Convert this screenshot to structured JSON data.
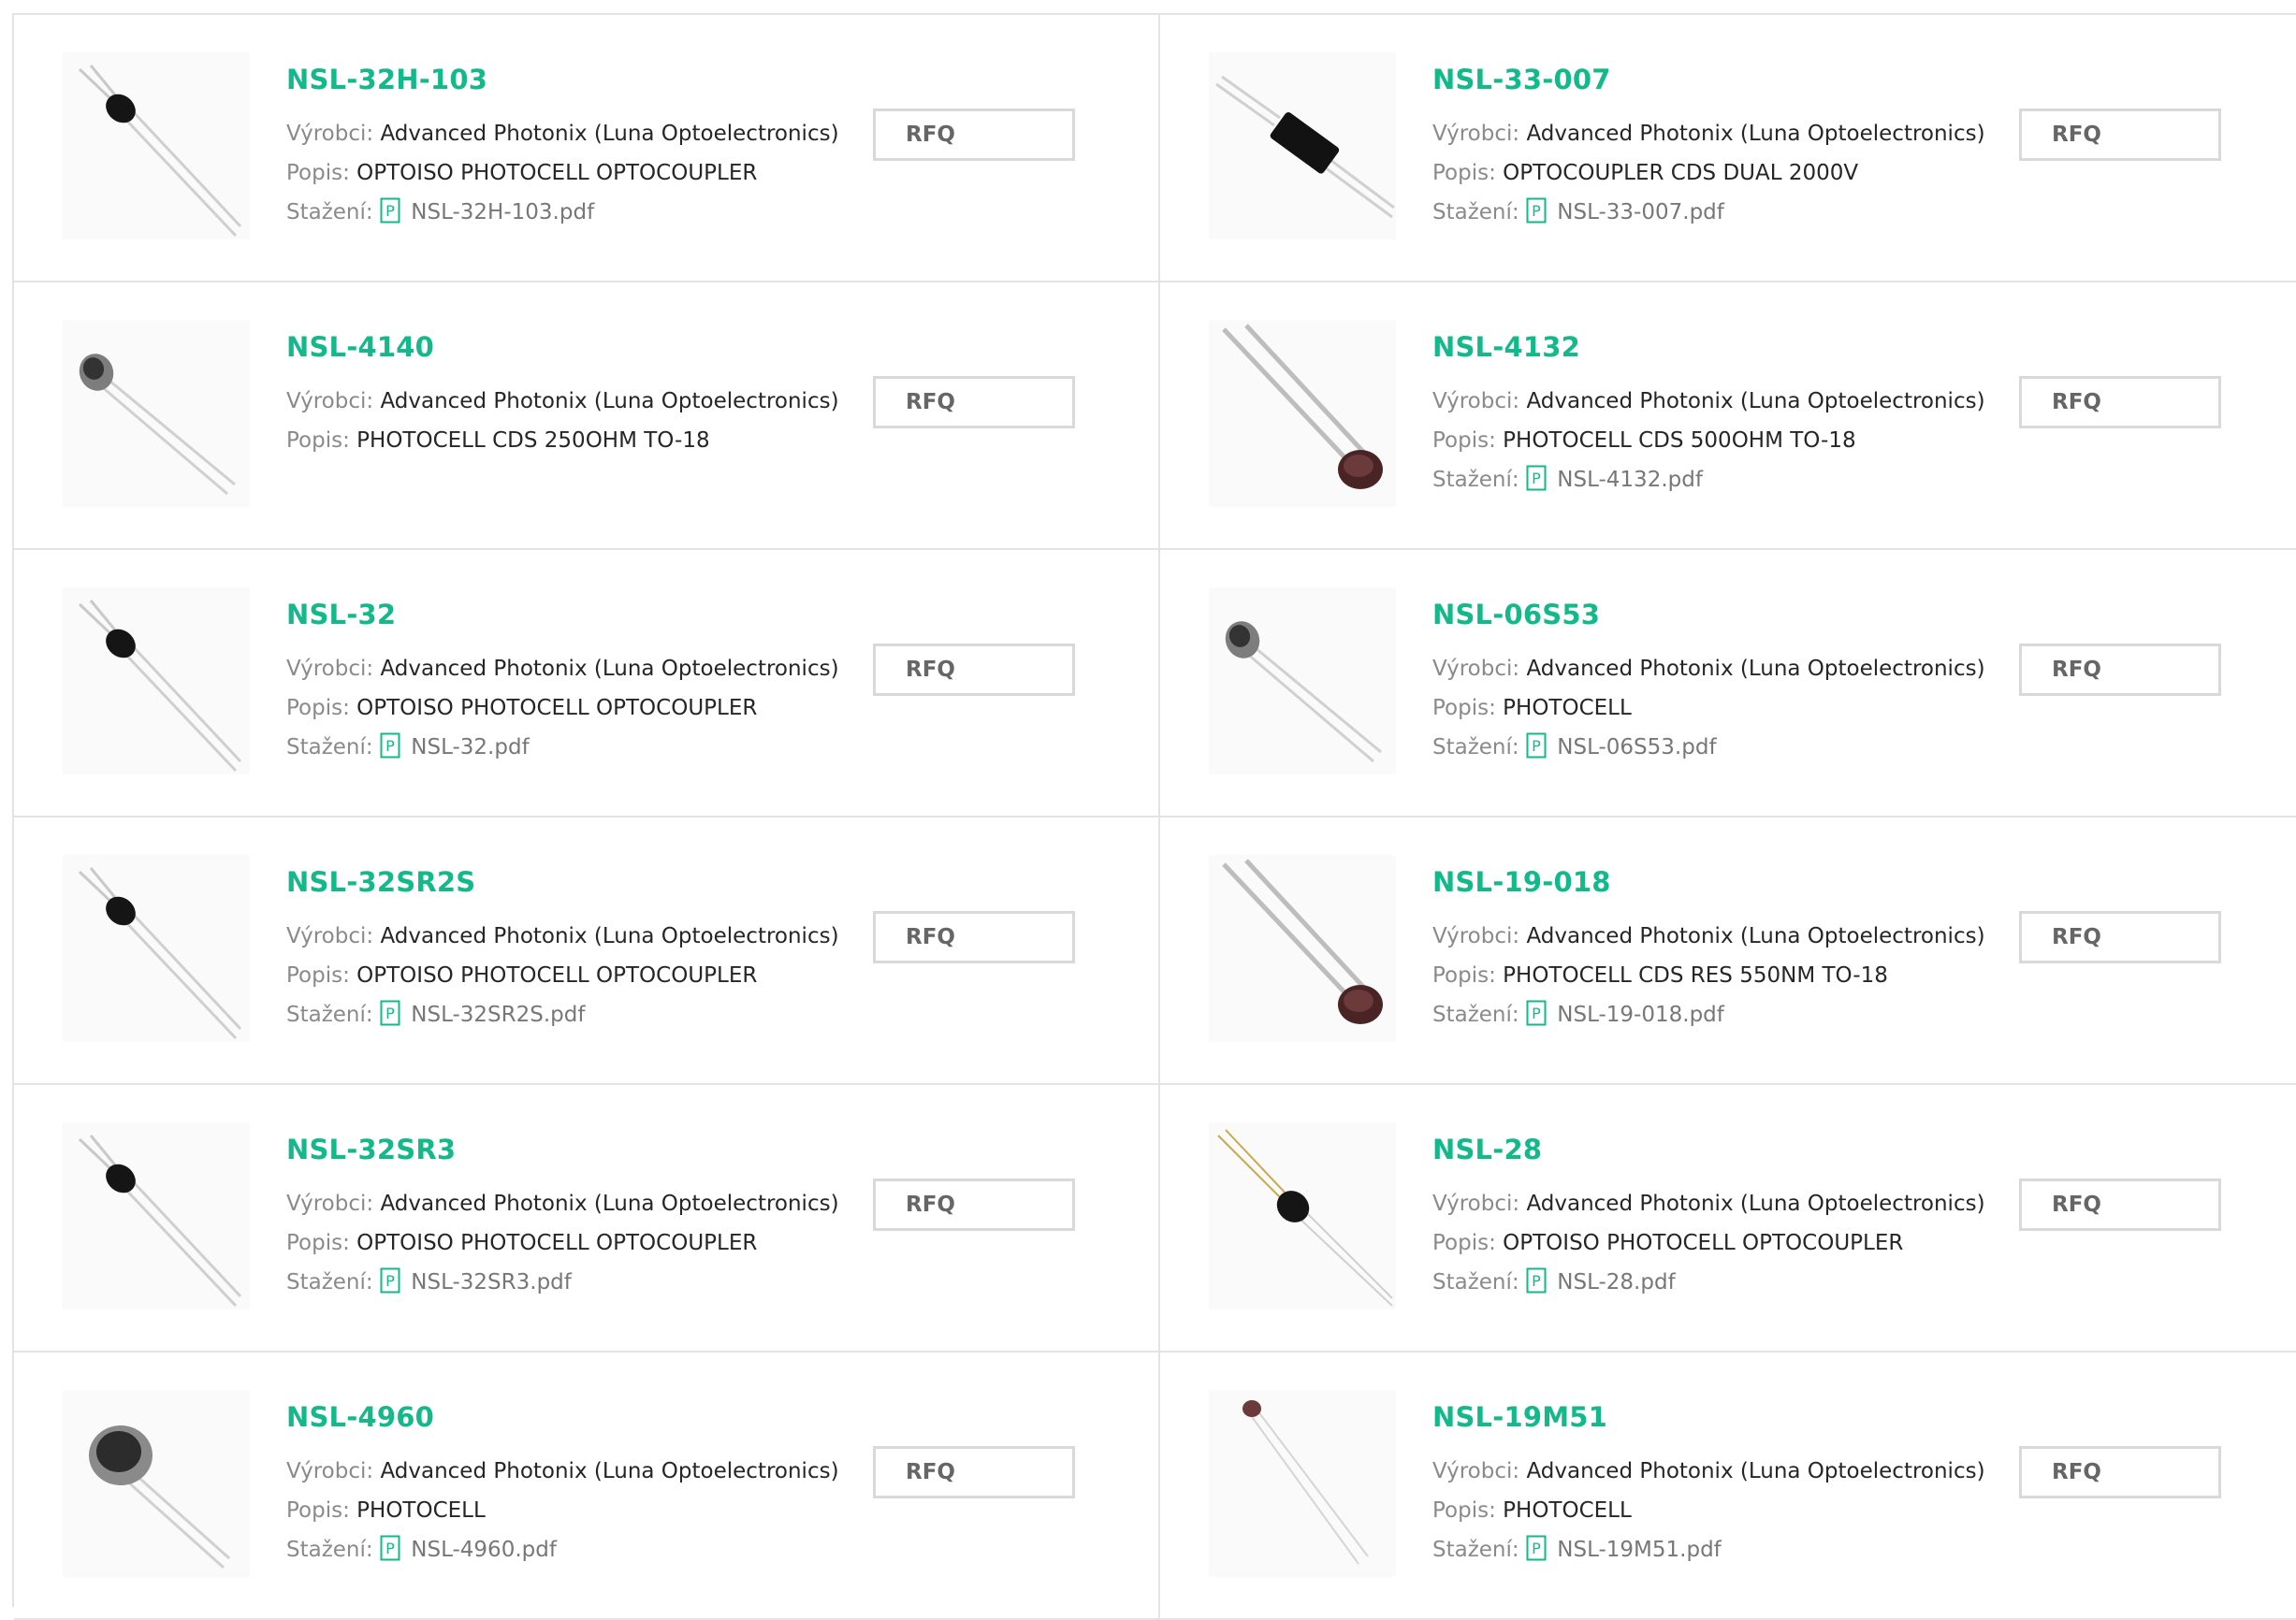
{
  "labels": {
    "manufacturer": "Výrobci:",
    "description": "Popis:",
    "download": "Stažení:",
    "rfq": "RFQ"
  },
  "colors": {
    "accent": "#13b98a",
    "label_gray": "#8a8a8a",
    "border": "#e3e3e3"
  },
  "products": [
    {
      "part": "NSL-32H-103",
      "manufacturer": "Advanced Photonix (Luna Optoelectronics)",
      "description": "OPTOISO PHOTOCELL OPTOCOUPLER",
      "pdf": "NSL-32H-103.pdf",
      "icon": "optocoupler-image"
    },
    {
      "part": "NSL-33-007",
      "manufacturer": "Advanced Photonix (Luna Optoelectronics)",
      "description": "OPTOCOUPLER CDS DUAL 2000V",
      "pdf": "NSL-33-007.pdf",
      "icon": "dual-optocoupler-image"
    },
    {
      "part": "NSL-4140",
      "manufacturer": "Advanced Photonix (Luna Optoelectronics)",
      "description": "PHOTOCELL CDS 250OHM TO-18",
      "pdf": null,
      "icon": "to18-photocell-image"
    },
    {
      "part": "NSL-4132",
      "manufacturer": "Advanced Photonix (Luna Optoelectronics)",
      "description": "PHOTOCELL CDS 500OHM TO-18",
      "pdf": "NSL-4132.pdf",
      "icon": "ldr-photocell-image"
    },
    {
      "part": "NSL-32",
      "manufacturer": "Advanced Photonix (Luna Optoelectronics)",
      "description": "OPTOISO PHOTOCELL OPTOCOUPLER",
      "pdf": "NSL-32.pdf",
      "icon": "optocoupler-image"
    },
    {
      "part": "NSL-06S53",
      "manufacturer": "Advanced Photonix (Luna Optoelectronics)",
      "description": "PHOTOCELL",
      "pdf": "NSL-06S53.pdf",
      "icon": "to18-photocell-image"
    },
    {
      "part": "NSL-32SR2S",
      "manufacturer": "Advanced Photonix (Luna Optoelectronics)",
      "description": "OPTOISO PHOTOCELL OPTOCOUPLER",
      "pdf": "NSL-32SR2S.pdf",
      "icon": "optocoupler-image"
    },
    {
      "part": "NSL-19-018",
      "manufacturer": "Advanced Photonix (Luna Optoelectronics)",
      "description": "PHOTOCELL CDS RES 550NM TO-18",
      "pdf": "NSL-19-018.pdf",
      "icon": "ldr-photocell-image"
    },
    {
      "part": "NSL-32SR3",
      "manufacturer": "Advanced Photonix (Luna Optoelectronics)",
      "description": "OPTOISO PHOTOCELL OPTOCOUPLER",
      "pdf": "NSL-32SR3.pdf",
      "icon": "optocoupler-image"
    },
    {
      "part": "NSL-28",
      "manufacturer": "Advanced Photonix (Luna Optoelectronics)",
      "description": "OPTOISO PHOTOCELL OPTOCOUPLER",
      "pdf": "NSL-28.pdf",
      "icon": "four-lead-optocoupler-image"
    },
    {
      "part": "NSL-4960",
      "manufacturer": "Advanced Photonix (Luna Optoelectronics)",
      "description": "PHOTOCELL",
      "pdf": "NSL-4960.pdf",
      "icon": "large-photocell-image"
    },
    {
      "part": "NSL-19M51",
      "manufacturer": "Advanced Photonix (Luna Optoelectronics)",
      "description": "PHOTOCELL",
      "pdf": "NSL-19M51.pdf",
      "icon": "mini-photocell-image"
    }
  ]
}
